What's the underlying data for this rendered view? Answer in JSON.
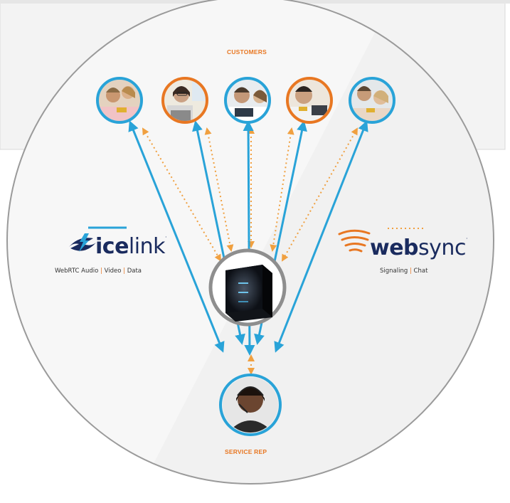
{
  "customers_label": "CUSTOMERS",
  "service_rep_label": "SERVICE REP",
  "icelink": {
    "brand_bold": "ice",
    "brand_light": "link",
    "trademark": "·",
    "subtitle_parts": [
      "WebRTC Audio",
      "Video",
      "Data"
    ],
    "separator": "|"
  },
  "websync": {
    "brand_bold": "web",
    "brand_light": "sync",
    "trademark": "·",
    "subtitle_parts": [
      "Signaling",
      "Chat"
    ],
    "separator": "|"
  },
  "colors": {
    "blue_line": "#29a3d8",
    "orange_dots": "#f0a040",
    "orange_accent": "#e87722",
    "navy": "#1a2b5e",
    "circle_border": "#9a9a9a"
  },
  "customers": [
    {
      "ring": "blue"
    },
    {
      "ring": "orange"
    },
    {
      "ring": "blue"
    },
    {
      "ring": "orange"
    },
    {
      "ring": "blue"
    }
  ]
}
